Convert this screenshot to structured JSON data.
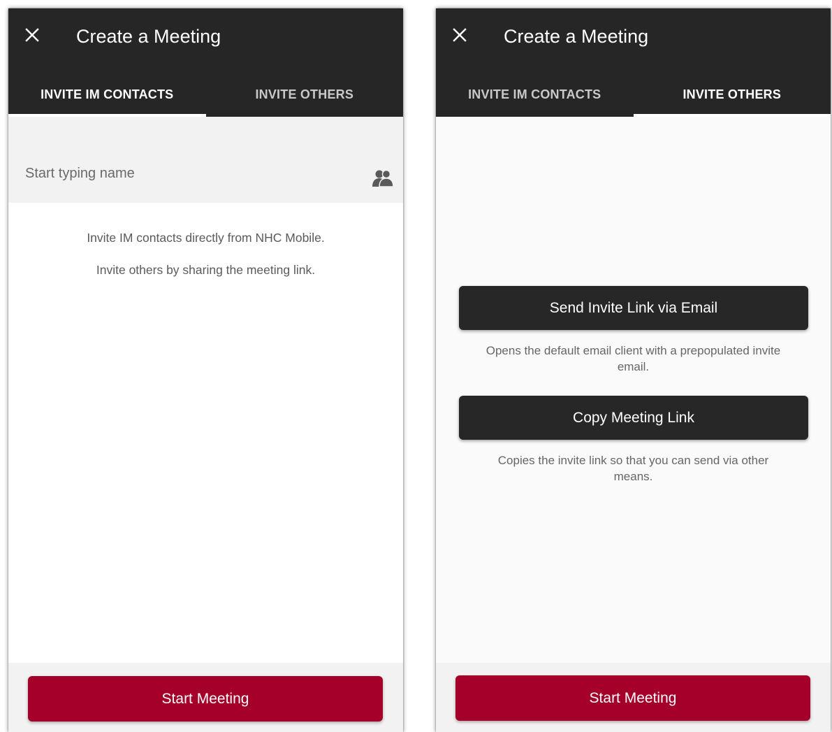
{
  "screens": [
    {
      "title": "Create a Meeting",
      "tabs": [
        "INVITE IM CONTACTS",
        "INVITE OTHERS"
      ],
      "active_tab": 0,
      "search": {
        "placeholder": "Start typing name",
        "icon": "contacts-icon"
      },
      "info_lines": [
        "Invite IM contacts directly from NHC Mobile.",
        "Invite others by sharing the meeting link."
      ],
      "start_button": "Start Meeting"
    },
    {
      "title": "Create a Meeting",
      "tabs": [
        "INVITE IM CONTACTS",
        "INVITE OTHERS"
      ],
      "active_tab": 1,
      "email_button": "Send Invite Link via Email",
      "email_help": "Opens the default email client with a prepopulated invite email.",
      "copy_button": "Copy Meeting Link",
      "copy_help": "Copies the invite link so that you can send via other means.",
      "start_button": "Start Meeting"
    }
  ],
  "colors": {
    "appbar": "#262626",
    "accent": "#a5002a",
    "dark_button": "#272727"
  }
}
